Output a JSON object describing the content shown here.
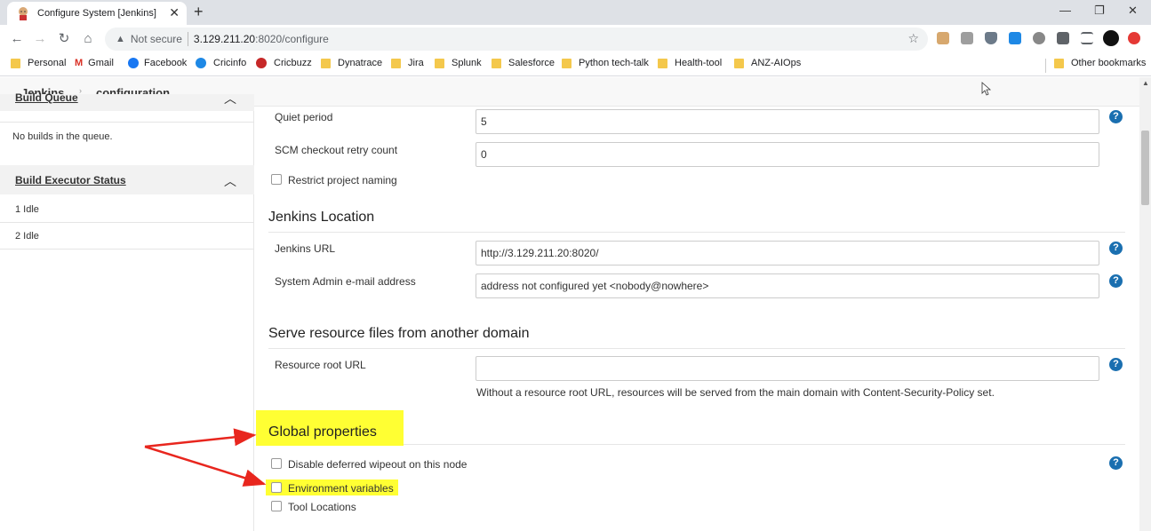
{
  "browser": {
    "tab_title": "Configure System [Jenkins]",
    "new_tab": "+",
    "close": "✕",
    "minimize": "—",
    "restore": "❐",
    "window_close": "✕",
    "not_secure": "Not secure",
    "url_host": "3.129.211.20",
    "url_path": ":8020/configure",
    "bookmarks": [
      "Personal",
      "Gmail",
      "Facebook",
      "Cricinfo",
      "Cricbuzz",
      "Dynatrace",
      "Jira",
      "Splunk",
      "Salesforce",
      "Python tech-talk",
      "Health-tool",
      "ANZ-AIOps"
    ],
    "other_bookmarks": "Other bookmarks"
  },
  "breadcrumb": {
    "root": "Jenkins",
    "separator": "›",
    "current": "configuration"
  },
  "sidebar": {
    "build_queue": {
      "title": "Build Queue",
      "empty_text": "No builds in the queue."
    },
    "executors": {
      "title": "Build Executor Status",
      "items": [
        "1  Idle",
        "2  Idle"
      ]
    }
  },
  "config": {
    "quiet_period": {
      "label": "Quiet period",
      "value": "5"
    },
    "scm_retry": {
      "label": "SCM checkout retry count",
      "value": "0"
    },
    "restrict_naming": {
      "label": "Restrict project naming",
      "checked": false
    },
    "jenkins_location": {
      "title": "Jenkins Location",
      "url_label": "Jenkins URL",
      "url_value": "http://3.129.211.20:8020/",
      "email_label": "System Admin e-mail address",
      "email_value": "address not configured yet <nobody@nowhere>"
    },
    "resource_domain": {
      "title": "Serve resource files from another domain",
      "root_label": "Resource root URL",
      "root_value": "",
      "hint": "Without a resource root URL, resources will be served from the main domain with Content-Security-Policy set."
    },
    "global_properties": {
      "title": "Global properties",
      "options": [
        {
          "label": "Disable deferred wipeout on this node",
          "checked": false
        },
        {
          "label": "Environment variables",
          "checked": false
        },
        {
          "label": "Tool Locations",
          "checked": false
        }
      ]
    },
    "help_glyph": "?"
  },
  "colors": {
    "highlight": "#ffff33",
    "annotation_arrow": "#e8261e",
    "help_icon": "#1a6fb0"
  }
}
